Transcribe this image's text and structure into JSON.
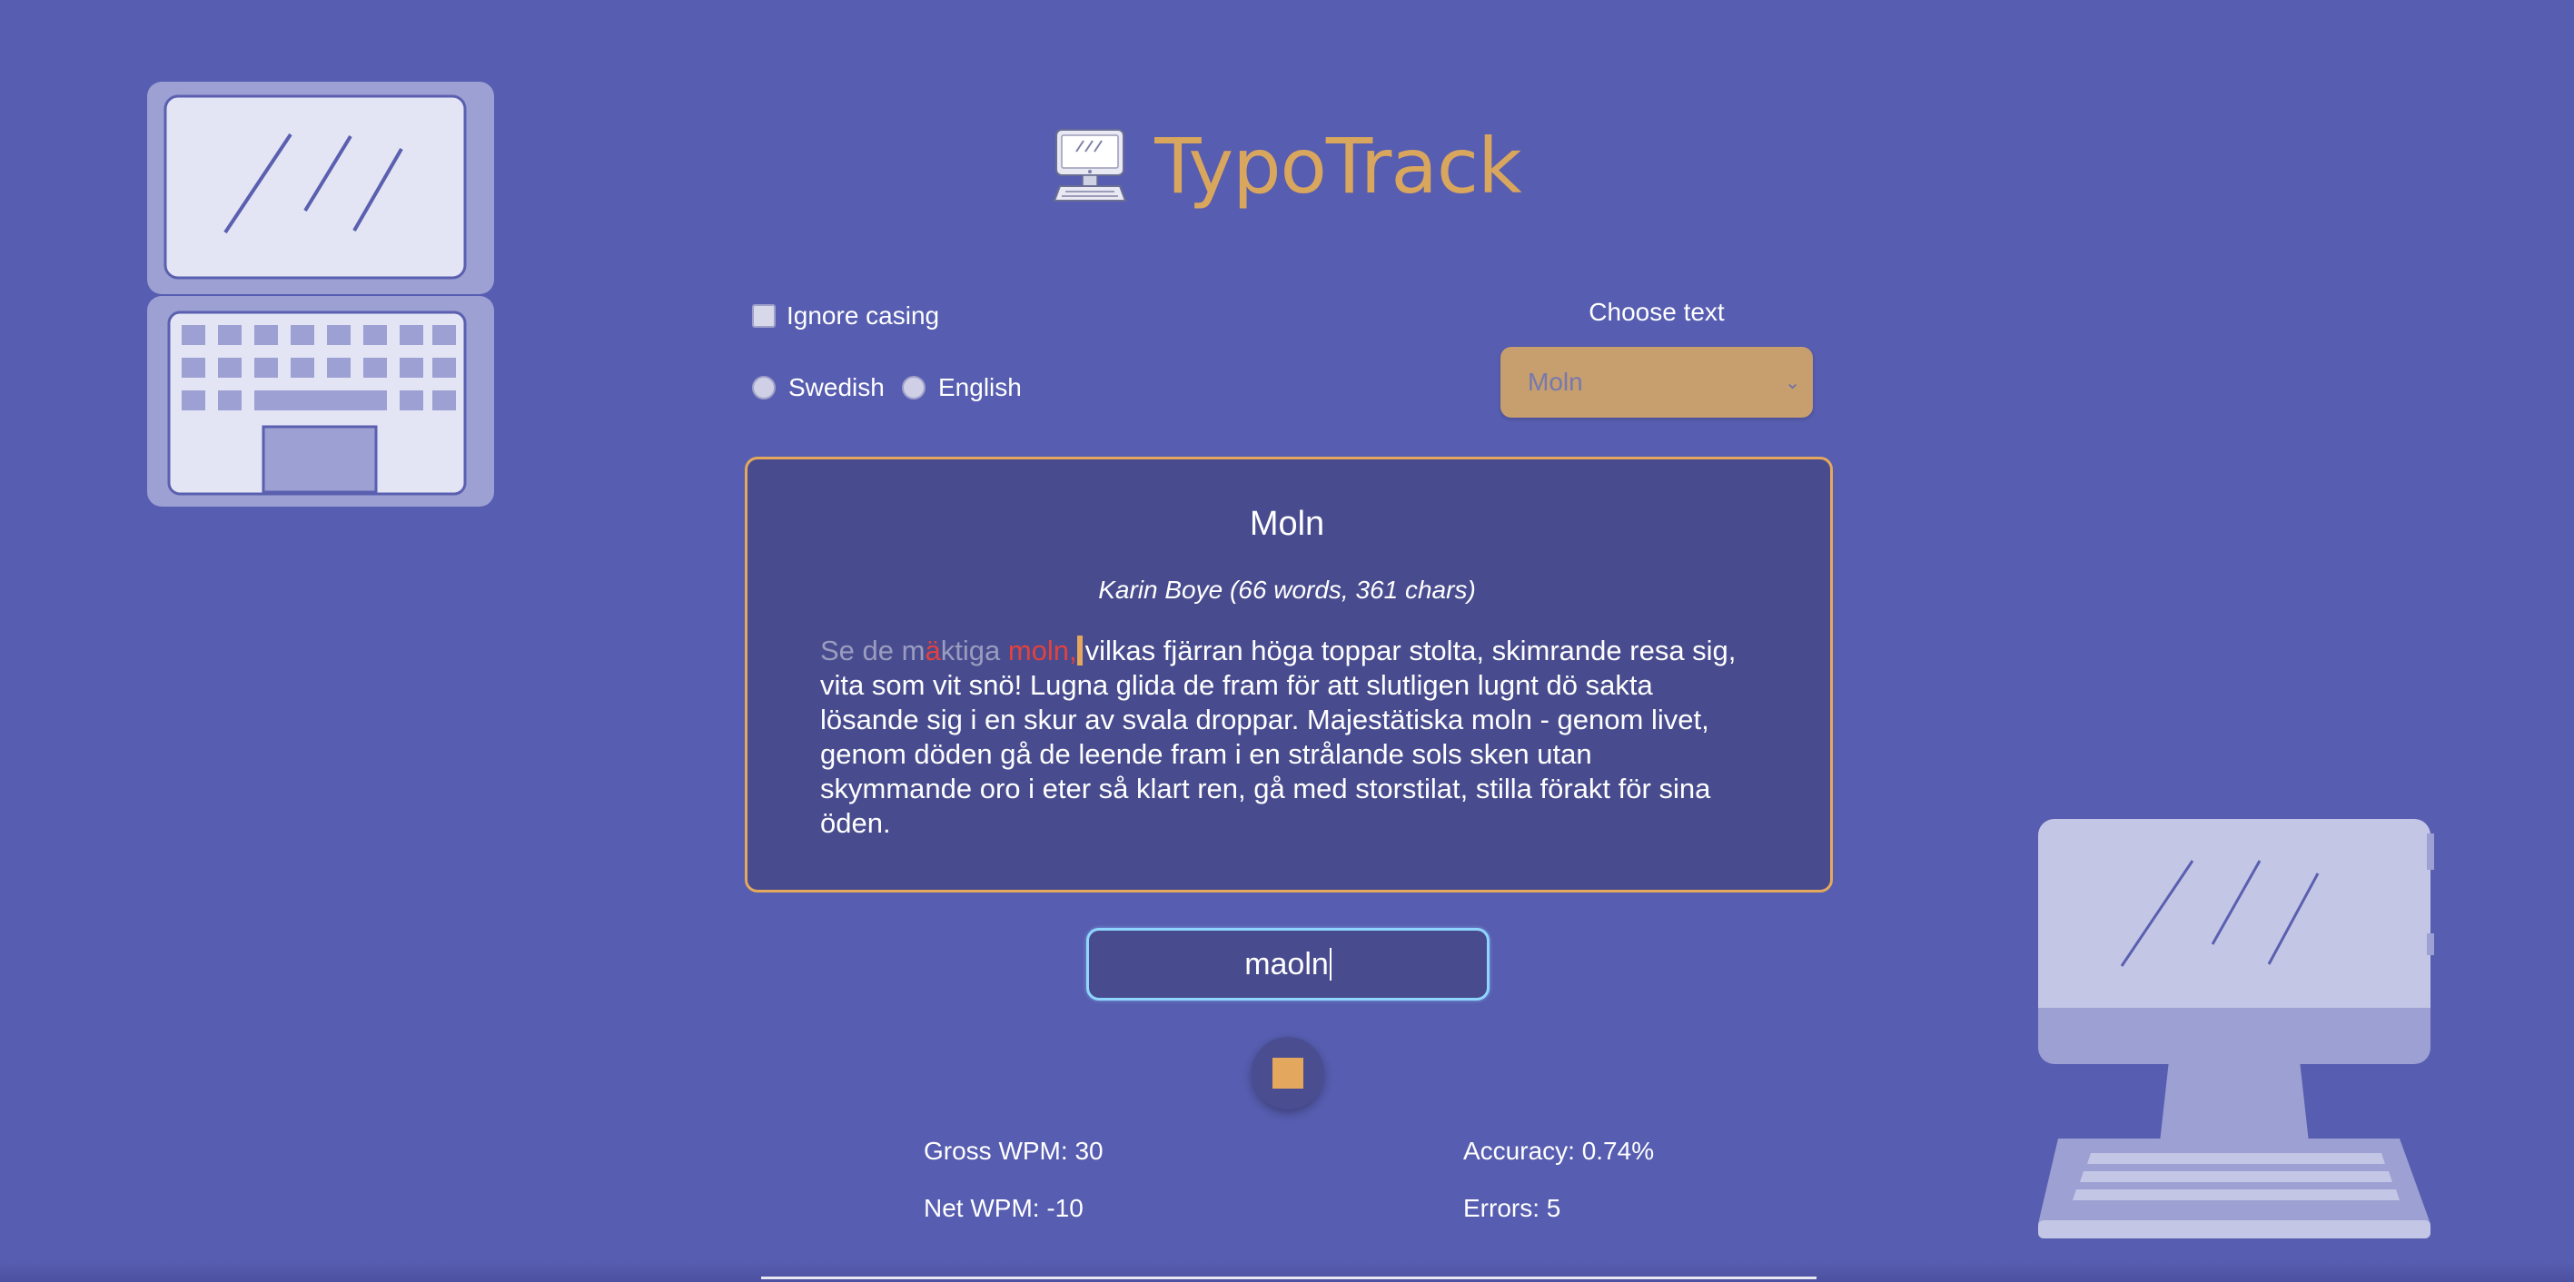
{
  "app": {
    "title": "TypoTrack",
    "logo_icon": "computer-icon",
    "accent": "#d9a65e"
  },
  "options": {
    "ignore_casing_label": "Ignore casing",
    "ignore_casing_checked": false,
    "languages": [
      "Swedish",
      "English"
    ],
    "selected_language": ""
  },
  "text_select": {
    "label": "Choose text",
    "value": "Moln"
  },
  "passage": {
    "title": "Moln",
    "meta": "Karin Boye (66 words, 361 chars)",
    "typed_correct_1": "Se de m",
    "typed_error_1": "ä",
    "typed_correct_2": "ktiga ",
    "typed_error_2": "moln,",
    "remaining": "vilkas fjärran höga toppar stolta, skimrande resa sig, vita som vit snö! Lugna glida de fram för att slutligen lugnt dö sakta lösande sig i en skur av svala droppar. Majestätiska moln - genom livet, genom döden gå de leende fram i en strålande sols sken utan skymmande oro i eter så klart ren, gå med storstilat, stilla förakt för sina öden."
  },
  "input": {
    "value": "maoln"
  },
  "stats": {
    "gross_wpm": "Gross WPM: 30",
    "net_wpm": "Net WPM: -10",
    "accuracy": "Accuracy: 0.74%",
    "errors": "Errors: 5"
  }
}
